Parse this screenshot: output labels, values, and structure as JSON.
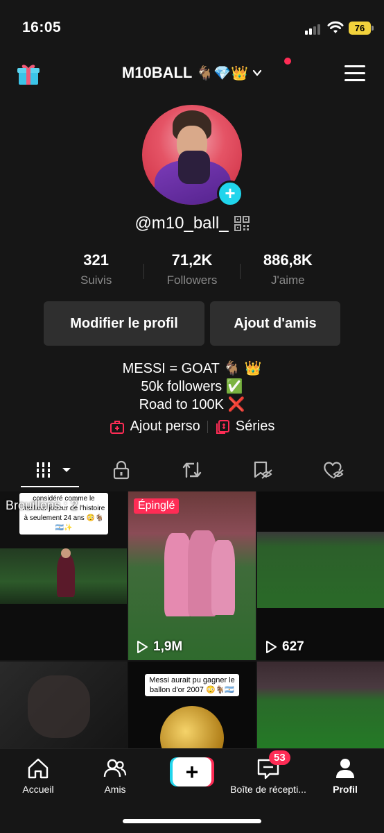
{
  "status_bar": {
    "time": "16:05",
    "battery": "76"
  },
  "header": {
    "username": "M10BALL",
    "username_emojis": "🐐💎👑"
  },
  "profile": {
    "handle": "@m10_ball_",
    "stats": [
      {
        "value": "321",
        "label": "Suivis"
      },
      {
        "value": "71,2K",
        "label": "Followers"
      },
      {
        "value": "886,8K",
        "label": "J'aime"
      }
    ],
    "edit_button": "Modifier le profil",
    "add_friends_button": "Ajout d'amis",
    "bio": [
      "MESSI = GOAT 🐐 👑",
      "50k followers ✅",
      "Road to 100K ❌"
    ],
    "links": {
      "add_personal": "Ajout perso",
      "series": "Séries"
    }
  },
  "grid": {
    "drafts_label": "Brouillons : 2",
    "drafts_caption": "considéré comme le meilleur joueur de l'histoire à seulement 24 ans 😳🐐🇦🇷✨",
    "pinned_label": "Épinglé",
    "videos": [
      {
        "views": "1,9M"
      },
      {
        "views": "627"
      }
    ],
    "row2_caption": "Messi aurait pu gagner le ballon d'or 2007 😳🐐🇦🇷"
  },
  "bottom_nav": {
    "items": [
      {
        "label": "Accueil"
      },
      {
        "label": "Amis"
      },
      {
        "label": "Boîte de récepti..."
      },
      {
        "label": "Profil"
      }
    ],
    "inbox_badge": "53"
  },
  "colors": {
    "accent": "#fe2c55",
    "teal": "#20d5ec",
    "background": "#161616"
  }
}
